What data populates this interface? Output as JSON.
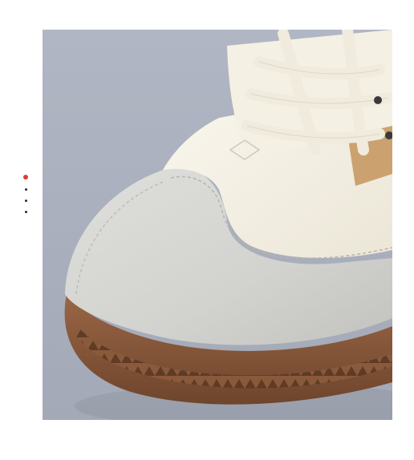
{
  "gallery": {
    "slide_count": 4,
    "active_index": 0,
    "colors": {
      "active_dot": "#e53935",
      "inactive_dot": "#2b2b2b",
      "backdrop": "#a9afbc",
      "leather": "#f3efe3",
      "suede": "#d5d5d2",
      "gum_sole": "#8a5a3b",
      "accent_tan": "#c69a63"
    }
  },
  "photo": {
    "subject": "sneaker-close-up"
  }
}
